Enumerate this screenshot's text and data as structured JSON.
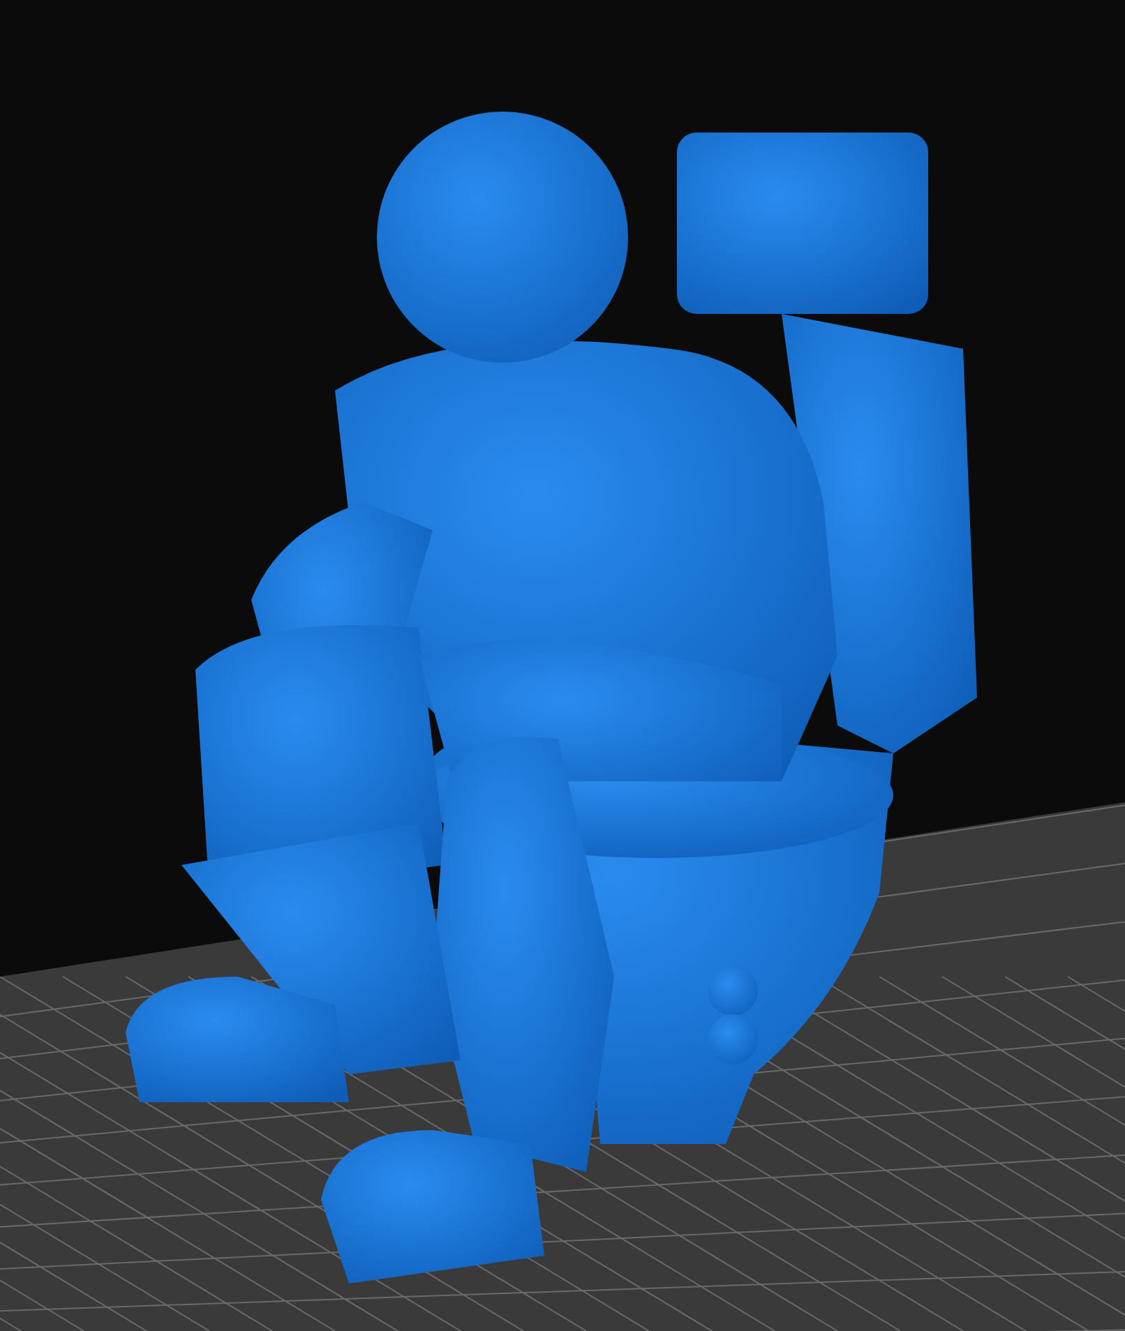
{
  "viewport": {
    "grid": true
  }
}
